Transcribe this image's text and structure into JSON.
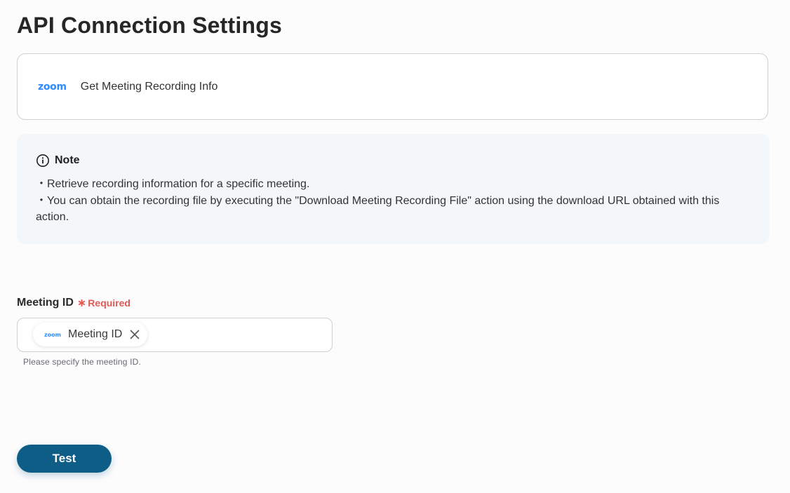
{
  "page": {
    "title": "API Connection Settings"
  },
  "app_card": {
    "logo_text": "zoom",
    "action_name": "Get Meeting Recording Info"
  },
  "note": {
    "icon": "info-icon",
    "title": "Note",
    "lines": [
      "・Retrieve recording information for a specific meeting.",
      "・You can obtain the recording file by executing the \"Download Meeting Recording File\" action using the download URL obtained with this action."
    ]
  },
  "meeting_id_field": {
    "label": "Meeting ID",
    "required_marker": "∗",
    "required_text": "Required",
    "chip": {
      "logo_text": "zoom",
      "label": "Meeting ID",
      "remove_icon": "close-icon"
    },
    "helper_text": "Please specify the meeting ID."
  },
  "actions": {
    "test_label": "Test"
  },
  "colors": {
    "zoom_brand": "#2d8cff",
    "required": "#e05a55",
    "primary_button": "#0d5d86",
    "note_background": "#f4f7fa"
  }
}
